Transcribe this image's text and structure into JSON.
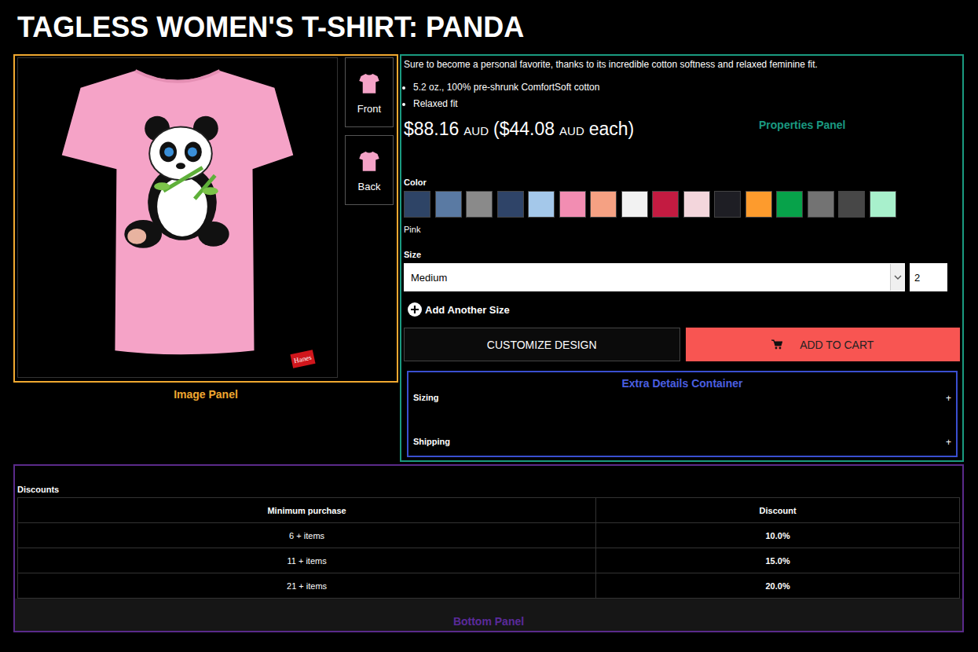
{
  "title": "TAGLESS WOMEN'S T-SHIRT: PANDA",
  "image_panel": {
    "label": "Image Panel",
    "brand_logo": "Hanes",
    "views": [
      {
        "label": "Front"
      },
      {
        "label": "Back"
      }
    ]
  },
  "properties_panel": {
    "label": "Properties Panel",
    "description": "Sure to become a personal favorite, thanks to its incredible cotton softness and relaxed feminine fit.",
    "features": [
      "5.2 oz., 100% pre-shrunk ComfortSoft cotton",
      "Relaxed fit"
    ],
    "price": [
      {
        "text": "$88.16",
        "small": false
      },
      {
        "text": "AUD",
        "small": true
      },
      {
        "text": "($44.08",
        "small": false
      },
      {
        "text": "AUD",
        "small": true
      },
      {
        "text": "each)",
        "small": false
      }
    ],
    "color": {
      "label": "Color",
      "selected_name": "Pink",
      "swatches": [
        {
          "color": "#2e4466"
        },
        {
          "color": "#5a7aa3"
        },
        {
          "color": "#8a8a8a"
        },
        {
          "color": "#2f4468"
        },
        {
          "color": "#a4c8ea"
        },
        {
          "color": "#f28db2"
        },
        {
          "color": "#f5a183"
        },
        {
          "color": "#f2f2f2"
        },
        {
          "color": "#c31b41"
        },
        {
          "color": "#f3d6dc"
        },
        {
          "color": "#1e1e24"
        },
        {
          "color": "#fd9b2d"
        },
        {
          "color": "#07a24a"
        },
        {
          "color": "#737373"
        },
        {
          "color": "#474747"
        },
        {
          "color": "#a8f0cc"
        }
      ]
    },
    "size": {
      "label": "Size",
      "value": "Medium",
      "quantity": "2",
      "add_label": "Add Another Size"
    },
    "buttons": {
      "customize": "CUSTOMIZE DESIGN",
      "add_to_cart": "ADD TO CART"
    },
    "extra_details": {
      "label": "Extra Details Container",
      "sections": [
        {
          "title": "Sizing",
          "toggle": "+",
          "expanded": false
        },
        {
          "title": "Shipping",
          "toggle": "+",
          "expanded": false
        }
      ]
    }
  },
  "bottom_panel": {
    "label": "Bottom Panel",
    "discounts": {
      "title": "Discounts",
      "columns": [
        "Minimum purchase",
        "Discount"
      ],
      "rows": [
        [
          "6 + items",
          "10.0%"
        ],
        [
          "11 + items",
          "15.0%"
        ],
        [
          "21 + items",
          "20.0%"
        ]
      ]
    }
  }
}
